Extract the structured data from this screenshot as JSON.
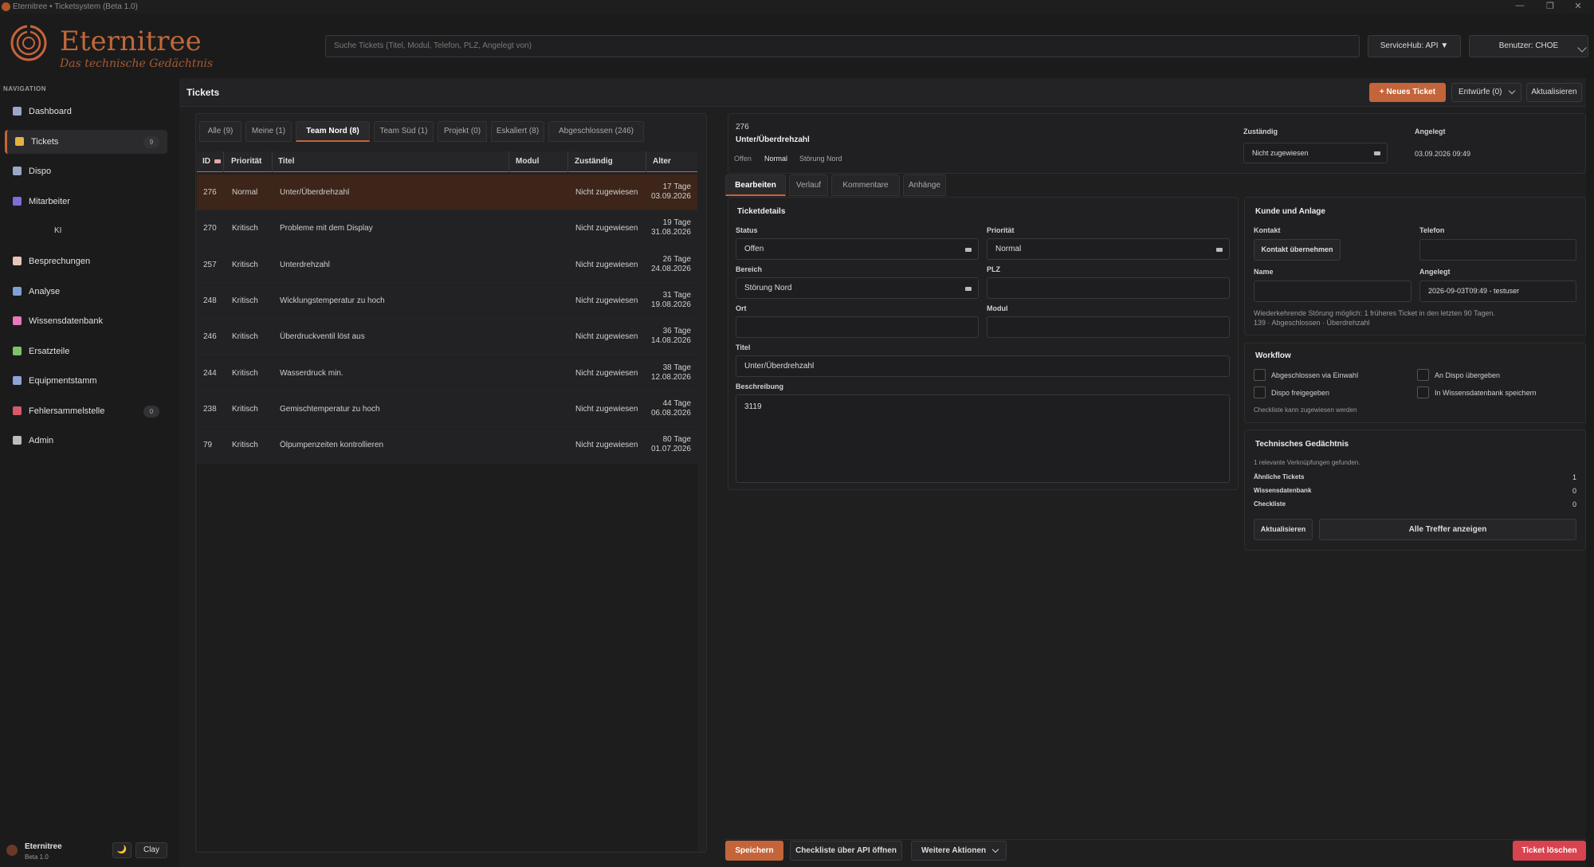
{
  "window": {
    "title": "Eternitree • Ticketsystem (Beta 1.0)"
  },
  "brand": {
    "name": "Eternitree",
    "tagline": "Das technische Gedächtnis"
  },
  "topbar": {
    "search_placeholder": "Suche Tickets (Titel, Modul, Telefon, PLZ, Angelegt von)",
    "servicehub_label": "ServiceHub: API ▼",
    "user_label": "Benutzer: CHOE"
  },
  "sidebar": {
    "section_label": "NAVIGATION",
    "items": [
      {
        "label": "Dashboard",
        "icon": "dashboard-icon",
        "color": "#9aa7c7"
      },
      {
        "label": "Tickets",
        "icon": "ticket-icon",
        "color": "#e3b341",
        "badge": "9"
      },
      {
        "label": "Dispo",
        "icon": "calendar-icon",
        "color": "#9aa7c7"
      },
      {
        "label": "Mitarbeiter",
        "icon": "person-icon",
        "color": "#7c6fd6"
      },
      {
        "label": "Besprechungen",
        "icon": "notes-icon",
        "color": "#e7c6b7"
      },
      {
        "label": "Analyse",
        "icon": "chart-icon",
        "color": "#7fa2d6"
      },
      {
        "label": "Wissensdatenbank",
        "icon": "brain-icon",
        "color": "#e878b8"
      },
      {
        "label": "Ersatzteile",
        "icon": "puzzle-icon",
        "color": "#7cc36a"
      },
      {
        "label": "Equipmentstamm",
        "icon": "equipment-icon",
        "color": "#8fa4d6"
      },
      {
        "label": "Fehlersammelstelle",
        "icon": "bug-icon",
        "color": "#d65a6a",
        "badge": "0"
      },
      {
        "label": "Admin",
        "icon": "gear-icon",
        "color": "#bdbdbd"
      }
    ],
    "ki_label": "KI",
    "footer": {
      "name": "Eternitree",
      "version": "Beta 1.0",
      "theme_icon": "🌙",
      "theme_label": "Clay"
    }
  },
  "header": {
    "title": "Tickets",
    "new_ticket": "+ Neues Ticket",
    "drafts": "Entwürfe (0)",
    "refresh": "Aktualisieren"
  },
  "list": {
    "tabs": [
      "Alle (9)",
      "Meine (1)",
      "Team Nord (8)",
      "Team Süd (1)",
      "Projekt (0)",
      "Eskaliert (8)",
      "Abgeschlossen (246)"
    ],
    "active_tab": 2,
    "columns": [
      "ID",
      "Priorität",
      "Titel",
      "Modul",
      "Zuständig",
      "Alter"
    ],
    "rows": [
      {
        "id": "276",
        "prio": "Normal",
        "title": "Unter/Überdrehzahl",
        "modul": "",
        "assignee": "Nicht zugewiesen",
        "age": "17 Tage",
        "date": "03.09.2026"
      },
      {
        "id": "270",
        "prio": "Kritisch",
        "title": "Probleme mit dem Display",
        "modul": "",
        "assignee": "Nicht zugewiesen",
        "age": "19 Tage",
        "date": "31.08.2026"
      },
      {
        "id": "257",
        "prio": "Kritisch",
        "title": "Unterdrehzahl",
        "modul": "",
        "assignee": "Nicht zugewiesen",
        "age": "26 Tage",
        "date": "24.08.2026"
      },
      {
        "id": "248",
        "prio": "Kritisch",
        "title": "Wicklungstemperatur zu hoch",
        "modul": "",
        "assignee": "Nicht zugewiesen",
        "age": "31 Tage",
        "date": "19.08.2026"
      },
      {
        "id": "246",
        "prio": "Kritisch",
        "title": "Überdruckventil löst aus",
        "modul": "",
        "assignee": "Nicht zugewiesen",
        "age": "36 Tage",
        "date": "14.08.2026"
      },
      {
        "id": "244",
        "prio": "Kritisch",
        "title": "Wasserdruck min.",
        "modul": "",
        "assignee": "Nicht zugewiesen",
        "age": "38 Tage",
        "date": "12.08.2026"
      },
      {
        "id": "238",
        "prio": "Kritisch",
        "title": "Gemischtemperatur zu hoch",
        "modul": "",
        "assignee": "Nicht zugewiesen",
        "age": "44 Tage",
        "date": "06.08.2026"
      },
      {
        "id": "79",
        "prio": "Kritisch",
        "title": "Ölpumpenzeiten kontrollieren",
        "modul": "",
        "assignee": "Nicht zugewiesen",
        "age": "80 Tage",
        "date": "01.07.2026"
      }
    ]
  },
  "detail": {
    "id": "276",
    "title": "Unter/Überdrehzahl",
    "status_chip": "Offen",
    "prio_chip": "Normal",
    "area_chip": "Störung Nord",
    "assignee_label": "Zuständig",
    "assignee_value": "Nicht zugewiesen",
    "created_label": "Angelegt",
    "created_value": "03.09.2026 09:49",
    "tabs": [
      "Bearbeiten",
      "Verlauf",
      "Kommentare",
      "Anhänge"
    ],
    "form": {
      "section": "Ticketdetails",
      "status_label": "Status",
      "status_value": "Offen",
      "prio_label": "Priorität",
      "prio_value": "Normal",
      "area_label": "Bereich",
      "area_value": "Störung Nord",
      "plz_label": "PLZ",
      "plz_value": "",
      "ort_label": "Ort",
      "ort_value": "",
      "modul_label": "Modul",
      "modul_value": "",
      "title_label": "Titel",
      "title_value": "Unter/Überdrehzahl",
      "desc_label": "Beschreibung",
      "desc_value": "3119"
    },
    "customer": {
      "section": "Kunde und Anlage",
      "contact_label": "Kontakt",
      "contact_button": "Kontakt übernehmen",
      "phone_label": "Telefon",
      "phone_value": "",
      "name_label": "Name",
      "name_value": "",
      "created_label": "Angelegt",
      "created_value": "2026-09-03T09:49 - testuser",
      "note1": "Wiederkehrende Störung möglich: 1 früheres Ticket in den letzten 90 Tagen.",
      "note2": "139 · Abgeschlossen · Überdrehzahl"
    },
    "workflow": {
      "section": "Workflow",
      "items": [
        "Abgeschlossen via Einwahl",
        "An Dispo übergeben",
        "Dispo freigegeben",
        "In Wissensdatenbank speichern"
      ],
      "note": "Checkliste kann zugewiesen werden"
    },
    "memory": {
      "section": "Technisches Gedächtnis",
      "summary": "1 relevante Verknüpfungen gefunden.",
      "rows": [
        {
          "label": "Ähnliche Tickets",
          "value": "1"
        },
        {
          "label": "Wissensdatenbank",
          "value": "0"
        },
        {
          "label": "Checkliste",
          "value": "0"
        }
      ],
      "refresh": "Aktualisieren",
      "all_hits": "Alle Treffer anzeigen"
    }
  },
  "footer": {
    "save": "Speichern",
    "checklist": "Checkliste über API öffnen",
    "more": "Weitere Aktionen",
    "delete": "Ticket löschen"
  },
  "colors": {
    "accent": "#c4643a",
    "danger": "#d9434f",
    "selected_row": "#3d2519"
  }
}
